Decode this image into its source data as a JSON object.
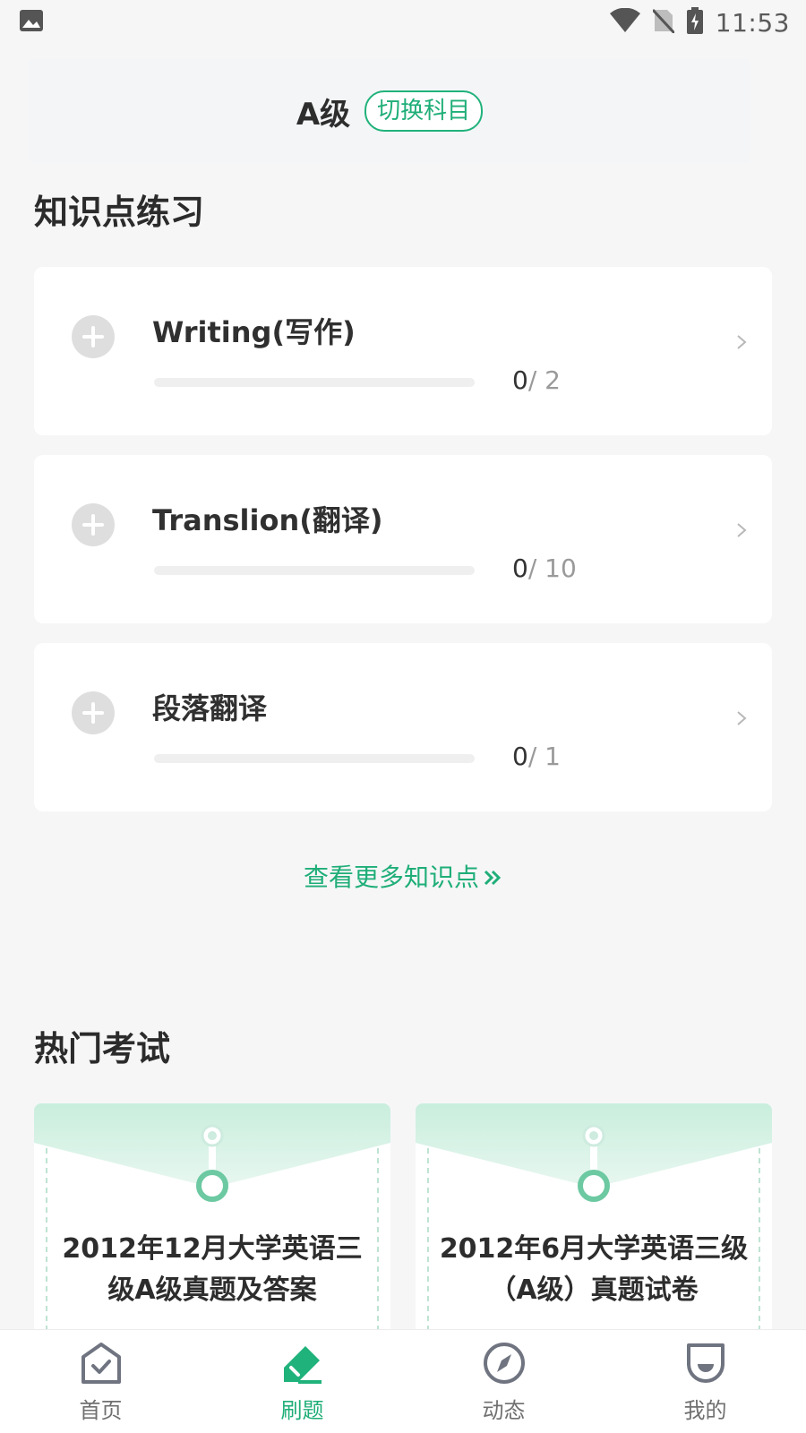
{
  "status_bar": {
    "time": "11:53"
  },
  "header": {
    "subject": "A级",
    "switch_label": "切换科目"
  },
  "knowledge": {
    "title": "知识点练习",
    "items": [
      {
        "title": "Writing(写作)",
        "done": "0",
        "total": "/ 2",
        "progress": 0
      },
      {
        "title": "Translion(翻译)",
        "done": "0",
        "total": "/ 10",
        "progress": 0
      },
      {
        "title": "段落翻译",
        "done": "0",
        "total": "/ 1",
        "progress": 0
      }
    ],
    "more_label": "查看更多知识点"
  },
  "exams": {
    "title": "热门考试",
    "items": [
      {
        "title": "2012年12月大学英语三级A级真题及答案"
      },
      {
        "title": "2012年6月大学英语三级（A级）真题试卷"
      }
    ]
  },
  "nav": {
    "items": [
      {
        "label": "首页",
        "icon": "home-check-icon"
      },
      {
        "label": "刷题",
        "icon": "pencil-icon",
        "active": true
      },
      {
        "label": "动态",
        "icon": "compass-icon"
      },
      {
        "label": "我的",
        "icon": "profile-icon"
      }
    ]
  },
  "colors": {
    "accent": "#1fae78",
    "background": "#f6f6f7"
  }
}
